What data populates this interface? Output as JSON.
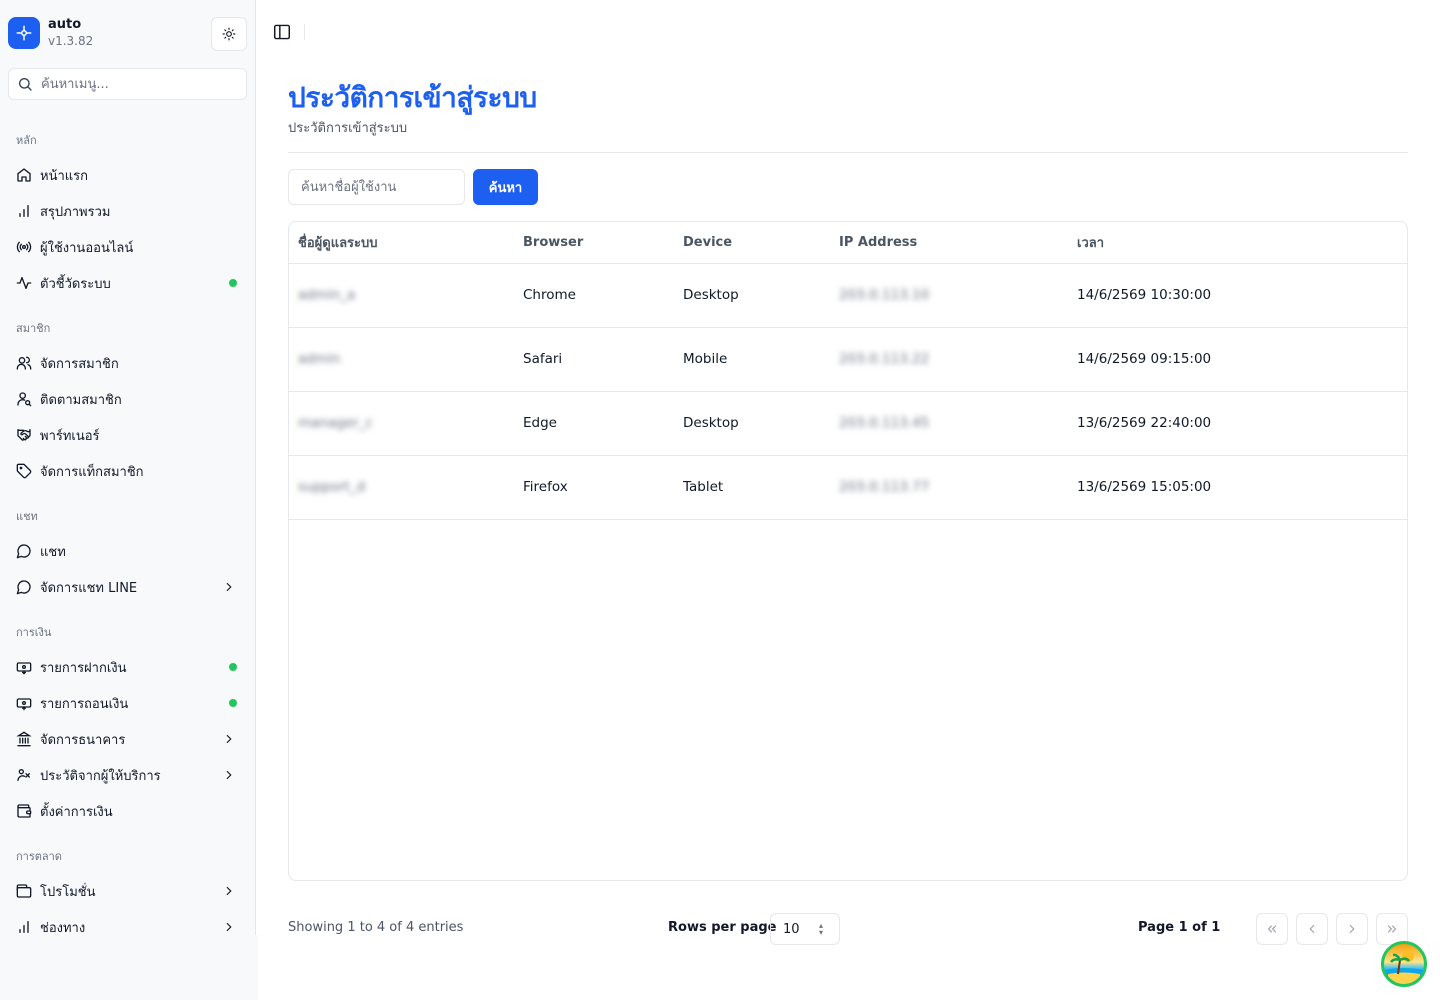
{
  "app": {
    "name": "auto",
    "version": "v1.3.82"
  },
  "sidebar": {
    "search_placeholder": "ค้นหาเมนู...",
    "groups": [
      {
        "label": "หลัก"
      },
      {
        "label": "สมาชิก"
      },
      {
        "label": "แชท"
      },
      {
        "label": "การเงิน"
      },
      {
        "label": "การตลาด"
      }
    ],
    "items": [
      {
        "label": "หน้าแรก",
        "icon": "home-icon"
      },
      {
        "label": "สรุปภาพรวม",
        "icon": "bar-chart-icon"
      },
      {
        "label": "ผู้ใช้งานออนไลน์",
        "icon": "radio-icon"
      },
      {
        "label": "ตัวชี้วัดระบบ",
        "icon": "activity-icon",
        "status_dot": true
      },
      {
        "label": "จัดการสมาชิก",
        "icon": "users-icon"
      },
      {
        "label": "ติดตามสมาชิก",
        "icon": "user-search-icon"
      },
      {
        "label": "พาร์ทเนอร์",
        "icon": "handshake-icon"
      },
      {
        "label": "จัดการแท็กสมาชิก",
        "icon": "tag-icon"
      },
      {
        "label": "แชท",
        "icon": "message-circle-icon"
      },
      {
        "label": "จัดการแชท LINE",
        "icon": "message-circle-icon",
        "has_submenu": true
      },
      {
        "label": "รายการฝากเงิน",
        "icon": "deposit-icon",
        "status_dot": true
      },
      {
        "label": "รายการถอนเงิน",
        "icon": "withdraw-icon",
        "status_dot": true
      },
      {
        "label": "จัดการธนาคาร",
        "icon": "bank-icon",
        "has_submenu": true
      },
      {
        "label": "ประวัติจากผู้ให้บริการ",
        "icon": "provider-history-icon",
        "has_submenu": true
      },
      {
        "label": "ตั้งค่าการเงิน",
        "icon": "wallet-icon"
      },
      {
        "label": "โปรโมชั่น",
        "icon": "gift-card-icon",
        "has_submenu": true
      },
      {
        "label": "ช่องทาง",
        "icon": "bar-chart-icon",
        "has_submenu": true
      }
    ]
  },
  "page": {
    "title": "ประวัติการเข้าสู่ระบบ",
    "subtitle": "ประวัติการเข้าสู่ระบบ"
  },
  "search": {
    "placeholder": "ค้นหาชื่อผู้ใช้งาน",
    "button_label": "ค้นหา"
  },
  "table": {
    "columns": [
      "ชื่อผู้ดูแลระบบ",
      "Browser",
      "Device",
      "IP Address",
      "เวลา"
    ],
    "rows": [
      {
        "admin": "admin_a",
        "browser": "Chrome",
        "device": "Desktop",
        "ip": "203.0.113.10",
        "time": "14/6/2569 10:30:00"
      },
      {
        "admin": "admin",
        "browser": "Safari",
        "device": "Mobile",
        "ip": "203.0.113.22",
        "time": "14/6/2569 09:15:00"
      },
      {
        "admin": "manager_c",
        "browser": "Edge",
        "device": "Desktop",
        "ip": "203.0.113.45",
        "time": "13/6/2569 22:40:00"
      },
      {
        "admin": "support_d",
        "browser": "Firefox",
        "device": "Tablet",
        "ip": "203.0.113.77",
        "time": "13/6/2569 15:05:00"
      }
    ]
  },
  "pagination": {
    "showing": "Showing 1 to 4 of 4 entries",
    "rows_per_page_label": "Rows per page",
    "rows_per_page": "10",
    "page_info": "Page 1 of 1"
  },
  "colors": {
    "accent": "#1d5ff0",
    "status_dot": "#22c55e",
    "border": "#e5e7eb"
  }
}
